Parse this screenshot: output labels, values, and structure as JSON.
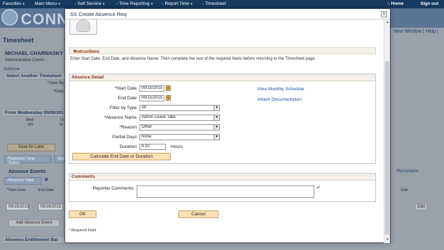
{
  "topnav": {
    "items": [
      "Favorites",
      "Main Menu",
      "Self Service",
      "Time Reporting",
      "Report Time",
      "Timesheet"
    ],
    "home": "Home",
    "signout": "Sign out"
  },
  "background": {
    "brand": "CONN",
    "page_title": "Timesheet",
    "employee_name": "MICHAEL CHARNASKY",
    "employee_title": "Administrative Comm",
    "actions": "Actions",
    "select_another": "Select Another Timesheet",
    "view_by": "*View By",
    "date_label": "*Date",
    "new_window": "New Window",
    "help": "Help",
    "period": "From Wednesday 09/09/201",
    "day1": "Wed",
    "day1_date": "9/9",
    "day2": "Th",
    "day2_date": "9/",
    "save_for_later": "Save for Later",
    "reported_time_status": "Reported Time Status",
    "summary": "Sum",
    "absence_events": "Absence Events",
    "absence_take_tab": "Absence Take",
    "personalize": "Personalize",
    "col_start": "*Start Date",
    "col_end": "End Date",
    "col_edit": "Edit",
    "row_start": "09/15/2015",
    "row_end": "09/16/2015",
    "add_absence_event": "Add Absence Event",
    "edit_btn": "Edit",
    "entitlement": "Absence Entitlement Bal"
  },
  "modal": {
    "title": "SS Create Absence Req",
    "close": "×",
    "instructions": {
      "heading": "Instructions",
      "text": "Enter Start Date, End Date, and Absence Name. Then complete the rest of the required fields before returning to the Timesheet page."
    },
    "absence_detail": {
      "heading": "Absence Detail",
      "start_date_label": "*Start Date",
      "start_date": "09/15/2015",
      "end_date_label": "End Date",
      "end_date": "09/15/2015",
      "filter_label": "Filter by Type",
      "filter_value": "All",
      "absence_name_label": "*Absence Name",
      "absence_name": "Admin Leave Take",
      "reason_label": "*Reason",
      "reason": "Other",
      "partial_days_label": "Partial Days",
      "partial_days": "None",
      "duration_label": "Duration",
      "duration": "8.00",
      "duration_unit": "Hours",
      "calc_button": "Calculate End Date or Duration",
      "view_monthly_schedule": "View Monthly Schedule",
      "attach_documentation": "Attach Documentation"
    },
    "comments": {
      "heading": "Comments",
      "reporter_label": "Reporter Comments:",
      "reporter_value": ""
    },
    "ok_button": "OK",
    "cancel_button": "Cancel",
    "required_note": "* Required Field"
  }
}
